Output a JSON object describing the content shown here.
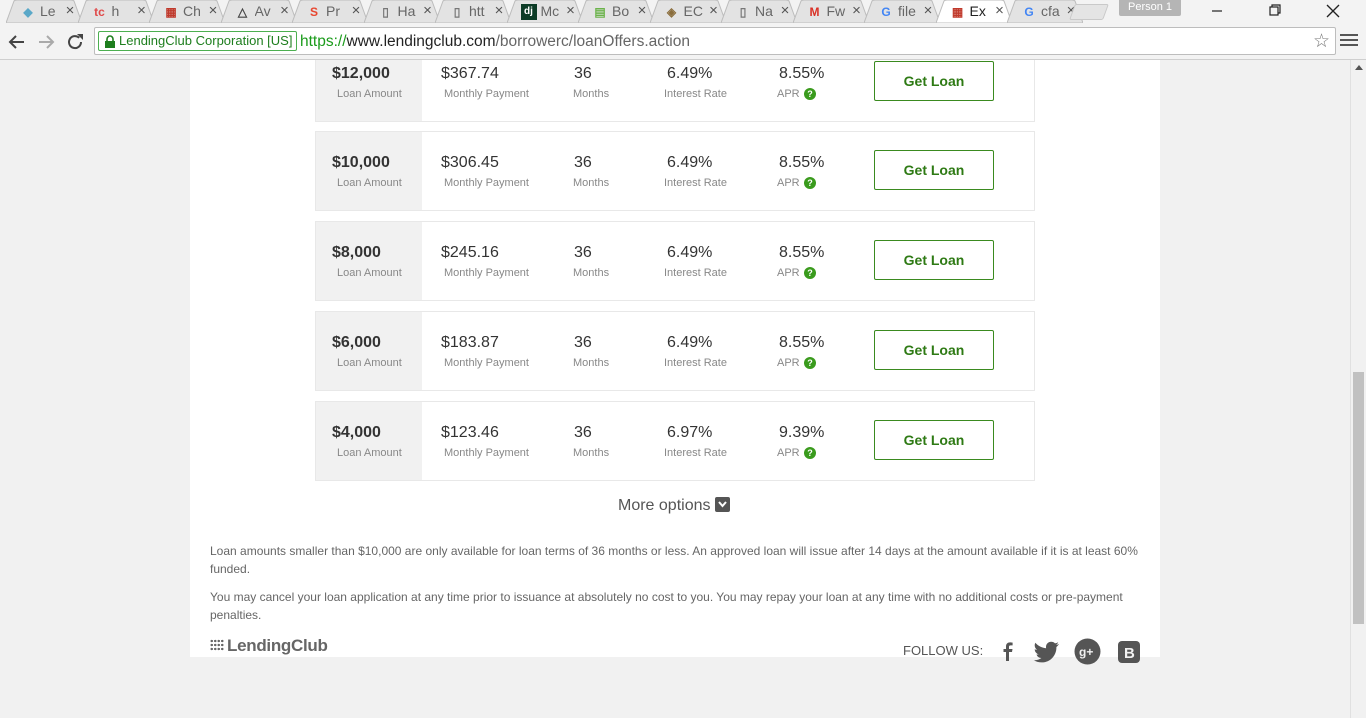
{
  "browser": {
    "tabs": [
      {
        "title": "Le",
        "icon": "cube-icon",
        "color": "#5aa8c8"
      },
      {
        "title": "h",
        "icon": "tc-icon",
        "color": "#e04a4a"
      },
      {
        "title": "Ch",
        "icon": "grid-icon",
        "color": "#c0392b"
      },
      {
        "title": "Av",
        "icon": "triangle-icon",
        "color": "#444444"
      },
      {
        "title": "Pr",
        "icon": "swirl-icon",
        "color": "#e8462f"
      },
      {
        "title": "Ha",
        "icon": "document-icon",
        "color": "#777777"
      },
      {
        "title": "htt",
        "icon": "document-icon",
        "color": "#777777"
      },
      {
        "title": "Mc",
        "icon": "dj-icon",
        "color": "#0c3c26"
      },
      {
        "title": "Bo",
        "icon": "chart-icon",
        "color": "#6bb34a"
      },
      {
        "title": "EC",
        "icon": "ecma-icon",
        "color": "#8a6d3b"
      },
      {
        "title": "Na",
        "icon": "document-icon",
        "color": "#777777"
      },
      {
        "title": "Fw",
        "icon": "gmail-icon",
        "color": "#d93025"
      },
      {
        "title": "file",
        "icon": "google-icon",
        "color": "#4285f4"
      },
      {
        "title": "Ex",
        "icon": "grid-icon",
        "color": "#c0392b",
        "active": true
      },
      {
        "title": "cfa",
        "icon": "google-icon",
        "color": "#4285f4"
      }
    ],
    "profile_name": "Person 1",
    "ev_label": "LendingClub Corporation [US]",
    "url_scheme": "https://",
    "url_host": "www.lendingclub.com",
    "url_path": "/borrowerc/loanOffers.action"
  },
  "labels": {
    "loan_amount": "Loan Amount",
    "monthly_payment": "Monthly Payment",
    "months": "Months",
    "interest_rate": "Interest Rate",
    "apr": "APR",
    "get_loan": "Get Loan",
    "help": "?"
  },
  "offers": [
    {
      "amount": "$12,000",
      "payment": "$367.74",
      "term": "36",
      "rate": "6.49%",
      "apr": "8.55%"
    },
    {
      "amount": "$10,000",
      "payment": "$306.45",
      "term": "36",
      "rate": "6.49%",
      "apr": "8.55%"
    },
    {
      "amount": "$8,000",
      "payment": "$245.16",
      "term": "36",
      "rate": "6.49%",
      "apr": "8.55%"
    },
    {
      "amount": "$6,000",
      "payment": "$183.87",
      "term": "36",
      "rate": "6.49%",
      "apr": "8.55%"
    },
    {
      "amount": "$4,000",
      "payment": "$123.46",
      "term": "36",
      "rate": "6.97%",
      "apr": "9.39%"
    }
  ],
  "more_options": "More options",
  "disclaimers": [
    "Loan amounts smaller than $10,000 are only available for loan terms of 36 months or less. An approved loan will issue after 14 days at the amount available if it is at least 60% funded.",
    "You may cancel your loan application at any time prior to issuance at absolutely no cost to you. You may repay your loan at any time with no additional costs or pre-payment penalties."
  ],
  "footer": {
    "logo": "LendingClub",
    "follow_us": "FOLLOW US:",
    "social": [
      "facebook-icon",
      "twitter-icon",
      "google-plus-icon",
      "blog-icon"
    ]
  },
  "colors": {
    "accent_green": "#3a8a1f",
    "secure_green": "#1a9b1a"
  }
}
